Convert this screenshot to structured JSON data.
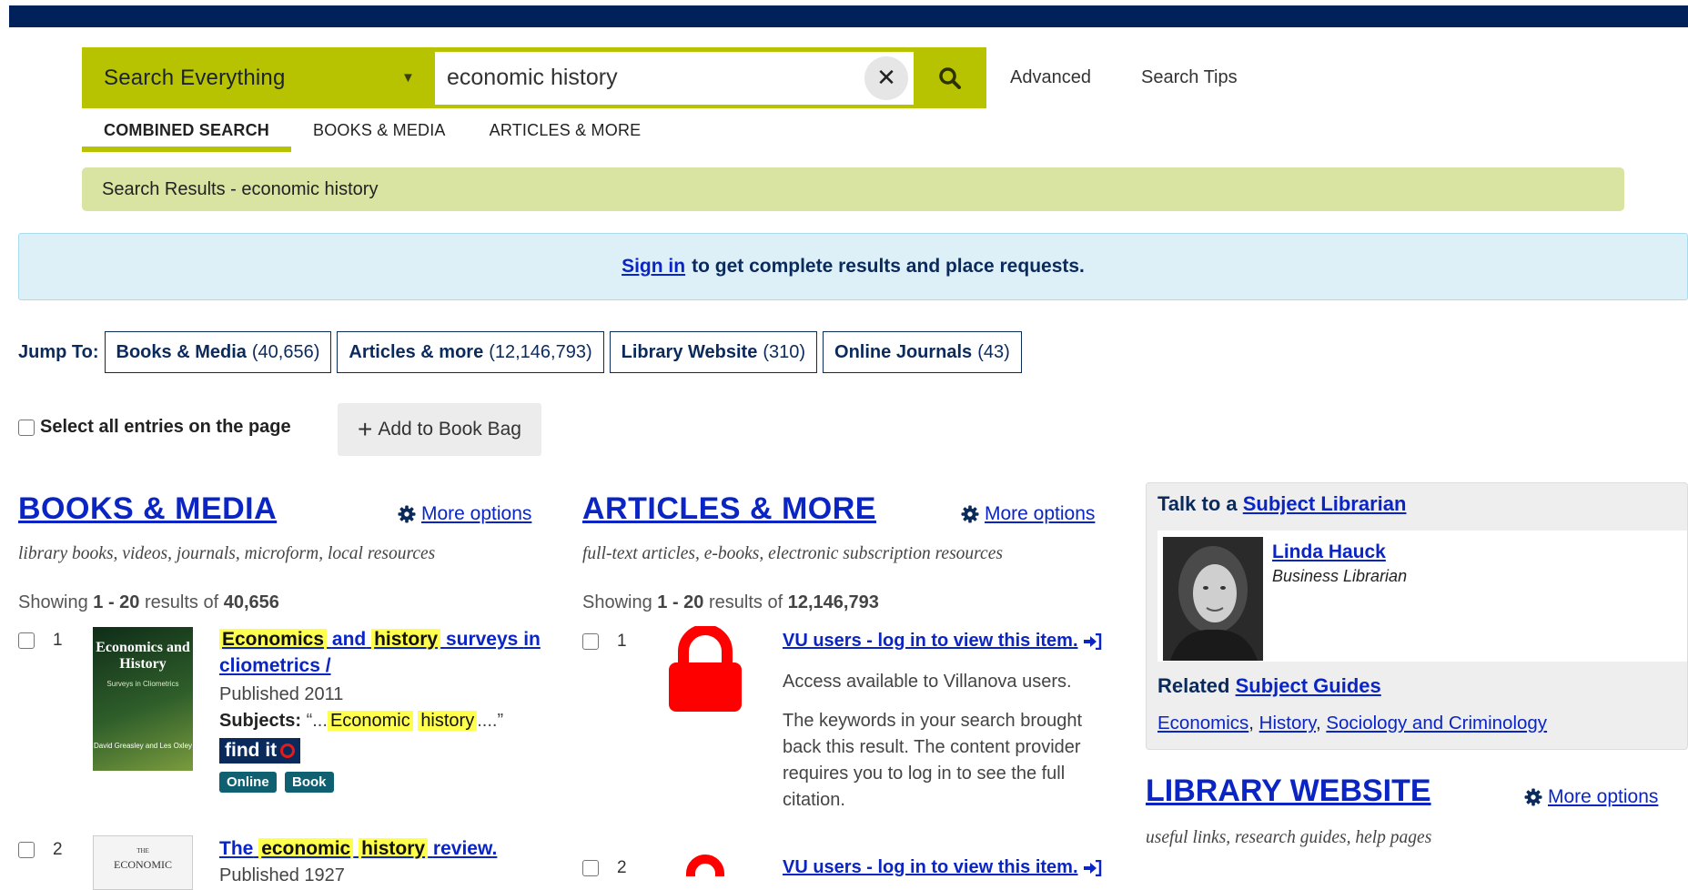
{
  "search": {
    "scope": "Search Everything",
    "query": "economic history",
    "advanced": "Advanced",
    "tips": "Search Tips"
  },
  "tabs": [
    {
      "label": "COMBINED SEARCH",
      "active": true
    },
    {
      "label": "BOOKS & MEDIA"
    },
    {
      "label": "ARTICLES & MORE"
    }
  ],
  "breadcrumb": "Search Results - economic history",
  "signin": {
    "link": "Sign in",
    "text": "to get complete results and place requests."
  },
  "jump": {
    "label": "Jump To:",
    "items": [
      {
        "name": "Books & Media",
        "count": "(40,656)"
      },
      {
        "name": "Articles & more",
        "count": "(12,146,793)"
      },
      {
        "name": "Library Website",
        "count": "(310)"
      },
      {
        "name": "Online Journals",
        "count": "(43)"
      }
    ]
  },
  "select_all": "Select all entries on the page",
  "add_to_bag": "Add to Book Bag",
  "more_options": "More options",
  "books": {
    "title": "BOOKS & MEDIA",
    "desc": "library books, videos, journals, microform, local resources",
    "showing_pre": "Showing",
    "range": "1 - 20",
    "results_of": "results of",
    "total": "40,656",
    "r1": {
      "num": "1",
      "t1": "Economics",
      "t2": "and",
      "t3": "history",
      "t4": "surveys",
      "t5": "in cliometrics /",
      "published": "Published 2011",
      "subjects_label": "Subjects:",
      "subjects_open": "“...",
      "s1": "Economic",
      "s2": "history",
      "subjects_close": "....”",
      "findit": "find it",
      "badge1": "Online",
      "badge2": "Book",
      "cover_title": "Economics and History",
      "cover_sub": "Surveys in Cliometrics",
      "cover_authors": "David Greasley and Les Oxley"
    },
    "r2": {
      "num": "2",
      "t1": "The",
      "t2": "economic",
      "t3": "history",
      "t4": "review.",
      "published": "Published 1927",
      "cover_top": "THE",
      "cover_title": "ECONOMIC"
    }
  },
  "articles": {
    "title": "ARTICLES & MORE",
    "desc": "full-text articles, e-books, electronic subscription resources",
    "showing_pre": "Showing",
    "range": "1 - 20",
    "results_of": "results of",
    "total": "12,146,793",
    "r1": {
      "num": "1",
      "login": "VU users - log in to view this item.",
      "access": "Access available to Villanova users.",
      "note": "The keywords in your search brought back this result. The content provider requires you to log in to see the full citation."
    },
    "r2": {
      "num": "2",
      "login": "VU users - log in to view this item."
    }
  },
  "sidebar": {
    "talk_pre": "Talk to a",
    "talk_link": "Subject Librarian",
    "librarian_name": "Linda Hauck",
    "librarian_role": "Business Librarian",
    "related_pre": "Related",
    "related_link": "Subject Guides",
    "guides": [
      "Economics",
      "History",
      "Sociology and Criminology"
    ]
  },
  "library_website": {
    "title": "LIBRARY WEBSITE",
    "desc": "useful links, research guides, help pages"
  },
  "colors": {
    "navy": "#002159",
    "lime": "#b7c300",
    "link": "#0a25c4",
    "highlight": "#ffff4d",
    "lock": "#ff0000"
  }
}
